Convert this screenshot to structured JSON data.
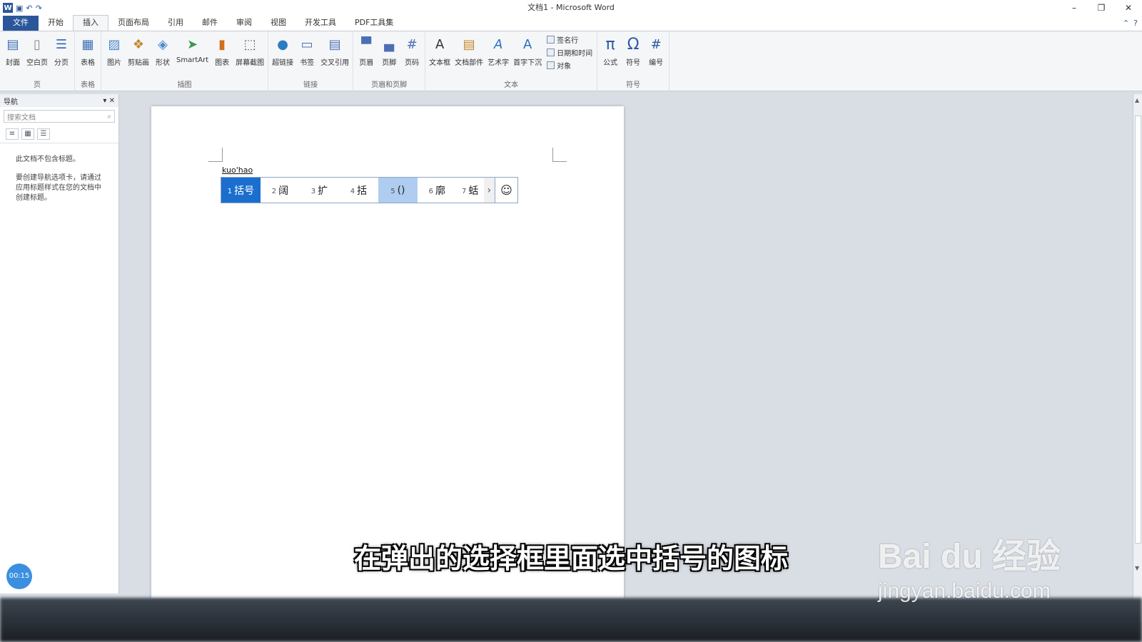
{
  "window": {
    "title": "文档1 - Microsoft Word",
    "controls": [
      "–",
      "❐",
      "✕"
    ],
    "qat_icons": [
      "save-icon",
      "undo-icon",
      "redo-icon"
    ]
  },
  "tabs": [
    {
      "label": "文件",
      "type": "file"
    },
    {
      "label": "开始"
    },
    {
      "label": "插入",
      "active": true
    },
    {
      "label": "页面布局"
    },
    {
      "label": "引用"
    },
    {
      "label": "邮件"
    },
    {
      "label": "审阅"
    },
    {
      "label": "视图"
    },
    {
      "label": "开发工具"
    },
    {
      "label": "PDF工具集"
    }
  ],
  "ribbon": {
    "groups": [
      {
        "name": "页",
        "buttons": [
          "封面",
          "空白页",
          "分页"
        ]
      },
      {
        "name": "表格",
        "buttons": [
          "表格"
        ]
      },
      {
        "name": "插图",
        "buttons": [
          "图片",
          "剪贴画",
          "形状",
          "SmartArt",
          "图表",
          "屏幕截图"
        ]
      },
      {
        "name": "链接",
        "buttons": [
          "超链接",
          "书签",
          "交叉引用"
        ]
      },
      {
        "name": "页眉和页脚",
        "buttons": [
          "页眉",
          "页脚",
          "页码"
        ]
      },
      {
        "name": "文本",
        "buttons": [
          "文本框",
          "文档部件",
          "艺术字",
          "首字下沉"
        ],
        "small": [
          "签名行",
          "日期和时间",
          "对象"
        ]
      },
      {
        "name": "符号",
        "buttons": [
          "公式",
          "符号",
          "编号"
        ]
      }
    ]
  },
  "nav": {
    "title": "导航",
    "search_placeholder": "搜索文档",
    "msg1": "此文档不包含标题。",
    "msg2": "要创建导航选项卡，请通过应用标题样式在您的文档中创建标题。"
  },
  "timer": "00:15",
  "document": {
    "composing": "kuo'hao"
  },
  "ime": {
    "candidates": [
      {
        "n": "1",
        "text": "括号",
        "state": "selected"
      },
      {
        "n": "2",
        "text": "阔"
      },
      {
        "n": "3",
        "text": "扩"
      },
      {
        "n": "4",
        "text": "括"
      },
      {
        "n": "5",
        "text": "()",
        "state": "hover"
      },
      {
        "n": "6",
        "text": "廓"
      },
      {
        "n": "7",
        "text": "蛞"
      }
    ]
  },
  "subtitle": "在弹出的选择框里面选中括号的图标",
  "watermark": {
    "brand": "Bai du 经验",
    "url": "jingyan.baidu.com"
  }
}
